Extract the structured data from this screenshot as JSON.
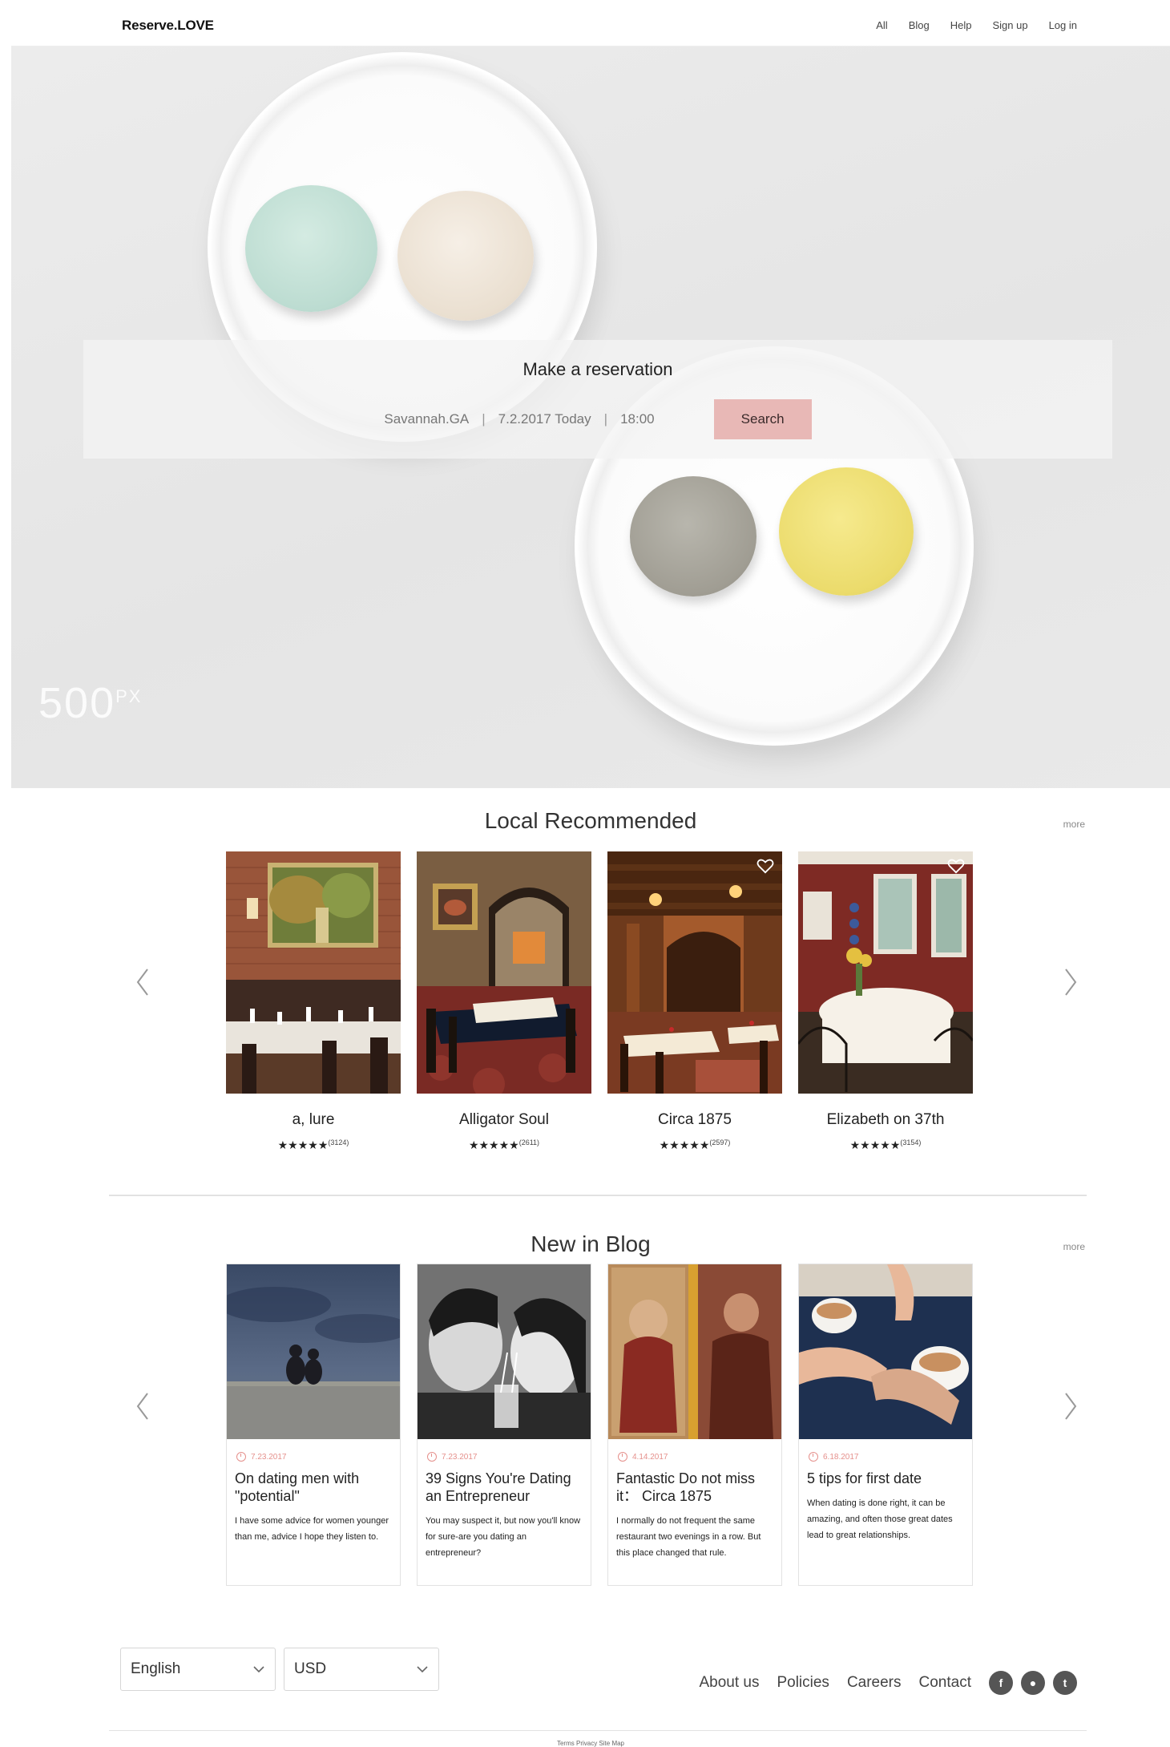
{
  "header": {
    "logo": "Reserve.LOVE",
    "nav": [
      "All",
      "Blog",
      "Help",
      "Sign up",
      "Log in"
    ]
  },
  "hero": {
    "title": "Make a reservation",
    "location": "Savannah.GA",
    "date": "7.2.2017 Today",
    "time": "18:00",
    "search_label": "Search",
    "watermark": "500",
    "watermark_sup": "PX"
  },
  "local": {
    "title": "Local Recommended",
    "more": "more",
    "restaurants": [
      {
        "name": "a, lure",
        "stars": "★★★★★",
        "count": "(3124)"
      },
      {
        "name": "Alligator Soul",
        "stars": "★★★★★",
        "count": "(2611)"
      },
      {
        "name": "Circa 1875",
        "stars": "★★★★★",
        "count": "(2597)"
      },
      {
        "name": "Elizabeth on 37th",
        "stars": "★★★★★",
        "count": "(3154)"
      }
    ]
  },
  "blog": {
    "title": "New in Blog",
    "more": "more",
    "posts": [
      {
        "date": "7.23.2017",
        "title": "On dating men with \"potential\"",
        "excerpt": "I have some advice for women younger than me, advice I hope they listen to."
      },
      {
        "date": "7.23.2017",
        "title": "39 Signs You're Dating an Entrepreneur",
        "excerpt": "You may suspect it, but now you'll know for sure-are you dating an entrepreneur?"
      },
      {
        "date": "4.14.2017",
        "title": "Fantastic Do not miss it： Circa 1875",
        "excerpt": "I normally do not frequent the same restaurant two evenings in a row. But this place changed that rule."
      },
      {
        "date": "6.18.2017",
        "title": "5 tips for first date",
        "excerpt": "When dating is done right, it can be amazing, and often those great dates lead to great relationships."
      }
    ]
  },
  "footer": {
    "language": "English",
    "currency": "USD",
    "links": [
      "About us",
      "Policies",
      "Careers",
      "Contact"
    ],
    "socials": [
      "f",
      "●",
      "t"
    ],
    "bottom": "Terms  Privacy  Site Map"
  },
  "colors": {
    "accent": "#e8b8b6",
    "date": "#e5908c"
  }
}
